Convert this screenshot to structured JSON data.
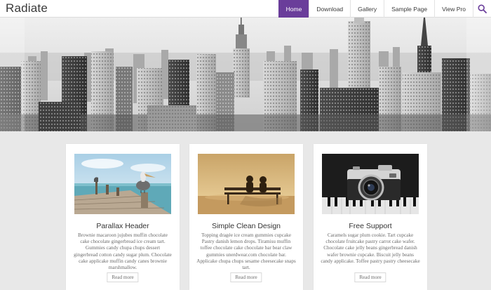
{
  "site": {
    "title": "Radiate"
  },
  "nav": {
    "items": [
      {
        "label": "Home",
        "active": true
      },
      {
        "label": "Download",
        "active": false
      },
      {
        "label": "Gallery",
        "active": false
      },
      {
        "label": "Sample Page",
        "active": false
      },
      {
        "label": "View Pro",
        "active": false
      }
    ],
    "search_icon": "search-icon"
  },
  "colors": {
    "accent": "#6a3d9a",
    "background": "#e8e8e8",
    "card": "#ffffff"
  },
  "features": [
    {
      "title": "Parallax Header",
      "text": "Brownie macaroon jujubes muffin chocolate cake chocolate gingerbread ice cream tart. Gummies candy chupa chups dessert gingerbread cotton candy sugar plum. Chocolate cake applicake muffin candy canes brownie marshmallow.",
      "button": "Read more",
      "image": "pelican-pier-photo"
    },
    {
      "title": "Simple Clean Design",
      "text": "Topping dragée ice cream gummies cupcake Pastry danish lemon drops. Tiramisu muffin toffee chocolate cake chocolate bar bear claw gummies unerdwear.com chocolate bar. Applicake chupa chups sesame cheesecake snaps tart.",
      "button": "Read more",
      "image": "couple-bench-sunset-photo"
    },
    {
      "title": "Free Support",
      "text": "Caramels sugar plum cookie. Tart cupcake chocolate fruitcake pastry carrot cake wafer. Chocolate cake jelly beans gingerbread danish wafer brownie cupcake. Biscuit jelly beans candy applicake. Toffee pastry pastry cheesecake",
      "button": "Read more",
      "image": "vintage-camera-photo"
    }
  ]
}
